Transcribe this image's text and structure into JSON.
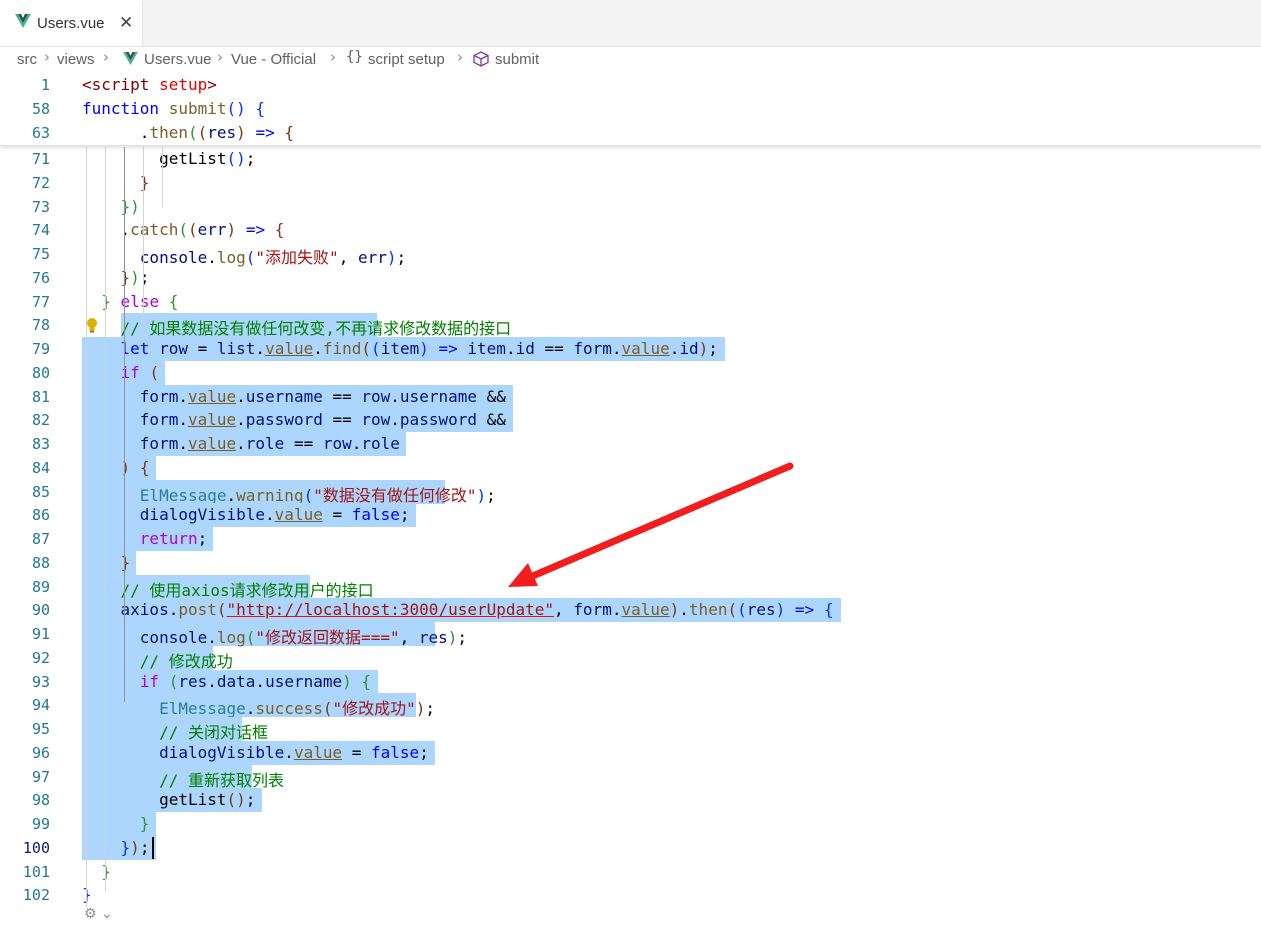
{
  "tab": {
    "label": "Users.vue",
    "close": "✕"
  },
  "breadcrumb": {
    "items": [
      "src",
      "views",
      "Users.vue",
      "Vue - Official",
      "script setup",
      "submit"
    ],
    "sep": "›"
  },
  "sticky": [
    {
      "num": "1",
      "html": "<span class='c-tag'>&lt;script</span> <span class='c-attr'>setup</span><span class='c-tag'>&gt;</span>"
    },
    {
      "num": "58",
      "html": "<span class='c-kw'>function</span> <span class='c-fn'>submit</span><span class='c-b1'>()</span> <span class='c-b1'>{</span>"
    },
    {
      "num": "63",
      "html": "      .<span class='c-fn'>then</span><span class='c-b2'>(</span><span class='c-b3'>(</span><span class='c-var'>res</span><span class='c-b3'>)</span> <span class='c-kw'>=&gt;</span> <span class='c-b3'>{</span>"
    }
  ],
  "lines": [
    {
      "num": "71",
      "html": "        getList<span class='c-b1'>()</span>;",
      "text_offset": 0
    },
    {
      "num": "72",
      "html": "      <span class='c-b3'>}</span>"
    },
    {
      "num": "73",
      "html": "    <span class='c-b2'>})</span>"
    },
    {
      "num": "74",
      "html": "    .<span class='c-fn'>catch</span><span class='c-b2'>(</span><span class='c-b3'>(</span><span class='c-var'>err</span><span class='c-b3'>)</span> <span class='c-kw'>=&gt;</span> <span class='c-b3'>{</span>"
    },
    {
      "num": "75",
      "html": "      <span class='c-var'>console</span>.<span class='c-fn'>log</span><span class='c-b1'>(</span><span class='c-str'>\"添加失败\"</span>, <span class='c-var'>err</span><span class='c-b1'>)</span>;"
    },
    {
      "num": "76",
      "html": "    <span class='c-b3'>}</span><span class='c-b2'>)</span>;"
    },
    {
      "num": "77",
      "html": "  <span class='c-b2'>}</span> <span class='c-ctl'>else</span> <span class='c-b2'>{</span>"
    },
    {
      "num": "78",
      "html": "    <span class='c-cmt'>// 如果数据没有做任何改变,不再请求修改数据的接口</span>"
    },
    {
      "num": "79",
      "html": "    <span class='c-kw'>let</span> <span class='c-var'>row</span> = <span class='c-var'>list</span>.<span class='c-deprec'>value</span>.<span class='c-fn'>find</span><span class='c-b3'>(</span><span class='c-b1'>(</span><span class='c-var'>item</span><span class='c-b1'>)</span> <span class='c-kw'>=&gt;</span> <span class='c-var'>item</span>.<span class='c-var'>id</span> == <span class='c-var'>form</span>.<span class='c-deprec'>value</span>.<span class='c-var'>id</span><span class='c-b3'>)</span>;"
    },
    {
      "num": "80",
      "html": "    <span class='c-ctl'>if</span> <span class='c-b3'>(</span>"
    },
    {
      "num": "81",
      "html": "      <span class='c-var'>form</span>.<span class='c-deprec'>value</span>.<span class='c-var'>username</span> == <span class='c-var'>row</span>.<span class='c-var'>username</span> &amp;&amp;"
    },
    {
      "num": "82",
      "html": "      <span class='c-var'>form</span>.<span class='c-deprec'>value</span>.<span class='c-var'>password</span> == <span class='c-var'>row</span>.<span class='c-var'>password</span> &amp;&amp;"
    },
    {
      "num": "83",
      "html": "      <span class='c-var'>form</span>.<span class='c-deprec'>value</span>.<span class='c-var'>role</span> == <span class='c-var'>row</span>.<span class='c-var'>role</span>"
    },
    {
      "num": "84",
      "html": "    <span class='c-b3'>)</span> <span class='c-b3'>{</span>"
    },
    {
      "num": "85",
      "html": "      <span class='c-cls'>ElMessage</span>.<span class='c-fn'>warning</span><span class='c-b1'>(</span><span class='c-str'>\"数据没有做任何修改\"</span><span class='c-b1'>)</span>;"
    },
    {
      "num": "86",
      "html": "      <span class='c-var'>dialogVisible</span>.<span class='c-deprec'>value</span> = <span class='c-kw'>false</span>;"
    },
    {
      "num": "87",
      "html": "      <span class='c-ctl'>return</span>;"
    },
    {
      "num": "88",
      "html": "    <span class='c-b3'>}</span>"
    },
    {
      "num": "89",
      "html": "    <span class='c-cmt'>// 使用axios请求修改用户的接口</span>"
    },
    {
      "num": "90",
      "html": "    <span class='c-var'>axios</span>.<span class='c-fn'>post</span><span class='c-b3'>(</span><span class='c-url'>\"http://localhost:3000/userUpdate\"</span>, <span class='c-var'>form</span>.<span class='c-deprec'>value</span><span class='c-b3'>)</span>.<span class='c-fn'>then</span><span class='c-b3'>(</span><span class='c-b1'>(</span><span class='c-var'>res</span><span class='c-b1'>)</span> <span class='c-kw'>=&gt;</span> <span class='c-b1'>{</span>"
    },
    {
      "num": "91",
      "html": "      <span class='c-var'>console</span>.<span class='c-fn'>log</span><span class='c-b2'>(</span><span class='c-str'>\"修改返回数据===\"</span>, <span class='c-var'>res</span><span class='c-b2'>)</span>;"
    },
    {
      "num": "92",
      "html": "      <span class='c-cmt'>// 修改成功</span>"
    },
    {
      "num": "93",
      "html": "      <span class='c-ctl'>if</span> <span class='c-b2'>(</span><span class='c-var'>res</span>.<span class='c-var'>data</span>.<span class='c-var'>username</span><span class='c-b2'>)</span> <span class='c-b2'>{</span>"
    },
    {
      "num": "94",
      "html": "        <span class='c-cls'>ElMessage</span>.<span class='c-fn'>success</span><span class='c-b3'>(</span><span class='c-str'>\"修改成功\"</span><span class='c-b3'>)</span>;"
    },
    {
      "num": "95",
      "html": "        <span class='c-cmt'>// 关闭对话框</span>"
    },
    {
      "num": "96",
      "html": "        <span class='c-var'>dialogVisible</span>.<span class='c-deprec'>value</span> = <span class='c-kw'>false</span>;"
    },
    {
      "num": "97",
      "html": "        <span class='c-cmt'>// 重新获取列表</span>"
    },
    {
      "num": "98",
      "html": "        getList<span class='c-b3'>()</span>;"
    },
    {
      "num": "99",
      "html": "      <span class='c-b2'>}</span>"
    },
    {
      "num": "100",
      "html": "    <span class='c-b1'>}</span><span class='c-b3'>)</span>;"
    },
    {
      "num": "101",
      "html": "  <span class='c-b2'>}</span>"
    },
    {
      "num": "102",
      "html": "<span class='c-b1'>}</span>"
    }
  ],
  "active_line": "100",
  "colors": {
    "selection": "#add6ff",
    "arrow": "#f01e1e",
    "line_number": "#237893"
  },
  "icons": [
    "vue-icon",
    "close-icon",
    "braces-icon",
    "cube-icon",
    "lightbulb-icon",
    "copilot-icon",
    "chevron-down-icon"
  ]
}
